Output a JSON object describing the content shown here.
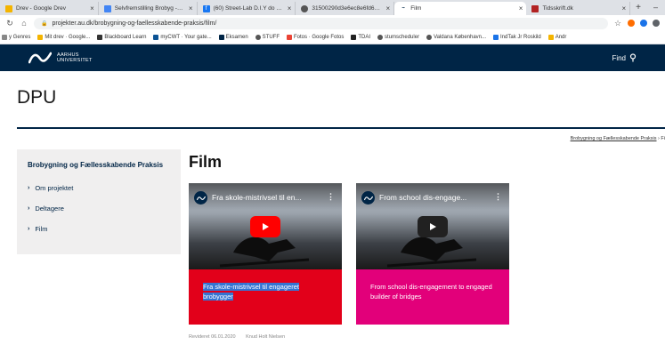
{
  "browser": {
    "tabs": [
      {
        "title": "Drev - Google Drev",
        "active": false,
        "favicon": "google-drive-icon",
        "color": "#f4b400"
      },
      {
        "title": "Selvfremstilling Brobyg - Goo",
        "active": false,
        "favicon": "google-docs-icon",
        "color": "#4285f4"
      },
      {
        "title": "(60) Street-Lab D.I.Y do it you",
        "active": false,
        "favicon": "facebook-icon",
        "color": "#1877f2"
      },
      {
        "title": "31500290d3e6ec8e6fd674e1",
        "active": false,
        "favicon": "globe-icon",
        "color": "#555555"
      },
      {
        "title": "Film",
        "active": true,
        "favicon": "au-logo-icon",
        "color": "#002546"
      },
      {
        "title": "Tidsskrift.dk",
        "active": false,
        "favicon": "tidsskrift-icon",
        "color": "#b22222"
      }
    ],
    "new_tab": "+",
    "url": "projekter.au.dk/brobygning-og-faellesskabende-praksis/film/",
    "bookmarks": [
      {
        "label": "y Genres",
        "color": "#888888"
      },
      {
        "label": "Mit drev · Google...",
        "color": "#f4b400"
      },
      {
        "label": "Blackboard Learn",
        "color": "#333333"
      },
      {
        "label": "myCWT · Your gate...",
        "color": "#0b5394"
      },
      {
        "label": "Eksamen",
        "color": "#002546"
      },
      {
        "label": "STUFF",
        "color": "#555555"
      },
      {
        "label": "Fotos · Google Fotos",
        "color": "#ea4335"
      },
      {
        "label": "TDAI",
        "color": "#222222"
      },
      {
        "label": "stumscheduler",
        "color": "#555555"
      },
      {
        "label": "Valdana København...",
        "color": "#555555"
      },
      {
        "label": "IndTak Jr Roskild",
        "color": "#1a73e8"
      },
      {
        "label": "Andr",
        "color": "#f4b400"
      }
    ]
  },
  "site_header": {
    "logo_line1": "AARHUS",
    "logo_line2": "UNIVERSITET",
    "find_label": "Find"
  },
  "page": {
    "site_title": "DPU",
    "breadcrumb_link": "Brobygning og Fællesskabende Praksis",
    "breadcrumb_sep": "›",
    "breadcrumb_current": "Fi",
    "heading": "Film"
  },
  "sidebar": {
    "title": "Brobygning og Fællesskabende Praksis",
    "items": [
      {
        "label": "Om projektet"
      },
      {
        "label": "Deltagere"
      },
      {
        "label": "Film"
      }
    ]
  },
  "videos": [
    {
      "yt_title": "Fra skole-mistrivsel til en...",
      "caption": "Fra skole-mistrivsel til engageret brobygger",
      "play_color": "#ff0000",
      "label_color": "#e2001a",
      "caption_selected": true
    },
    {
      "yt_title": "From school dis-engage...",
      "caption": "From school dis-engagement to engaged builder of bridges",
      "play_color": "#212121",
      "label_color": "#e2007a",
      "caption_selected": false
    }
  ],
  "footer": {
    "revised": "Revideret 06.01.2020",
    "author": "Knud Holt Nielsen"
  },
  "colors": {
    "au_navy": "#002546",
    "sidebar_bg": "#f0efef"
  }
}
